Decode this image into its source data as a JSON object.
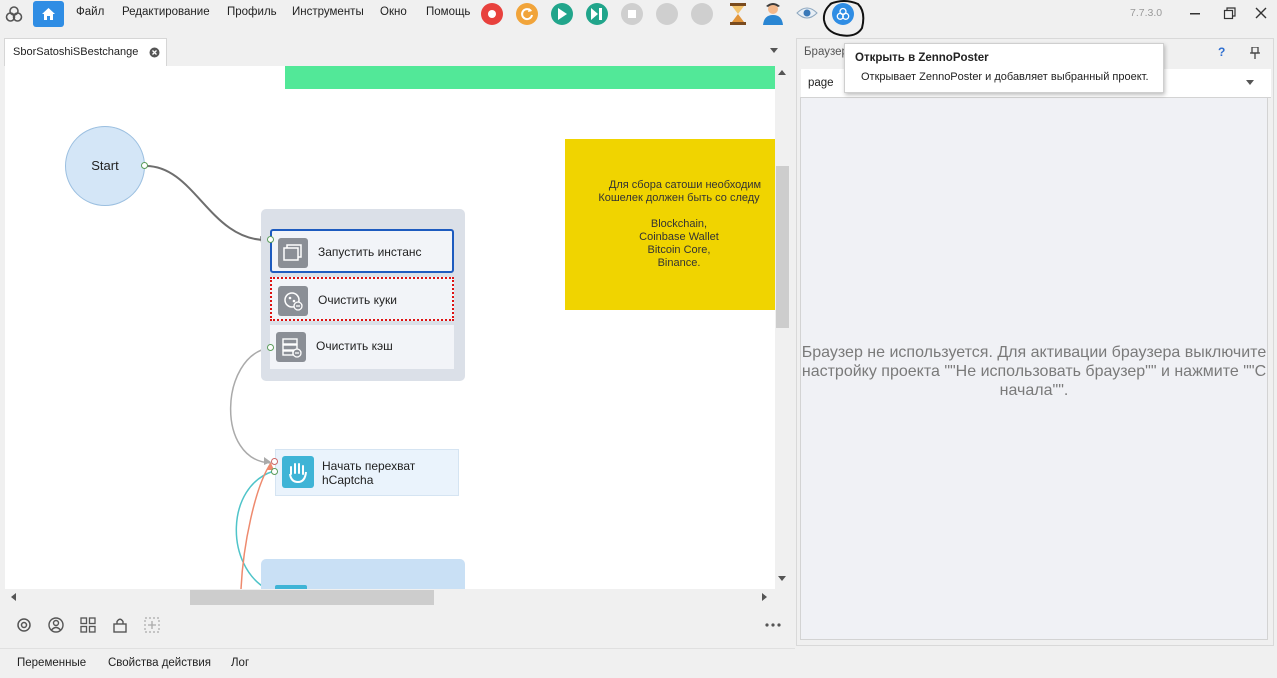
{
  "menu": {
    "file": "Файл",
    "edit": "Редактирование",
    "profile": "Профиль",
    "tools": "Инструменты",
    "window": "Окно",
    "help": "Помощь"
  },
  "toolbar_icons": [
    "home-icon",
    "record-icon",
    "refresh-icon",
    "play-icon",
    "step-icon",
    "stop-icon",
    "disabled-circle-icon",
    "disabled-circle-icon",
    "hourglass-icon",
    "user-icon",
    "eye-icon",
    "zennoposter-icon"
  ],
  "version": "7.7.3.0",
  "tabs": {
    "project": "SborSatoshiSBestchange"
  },
  "canvas": {
    "start_label": "Start",
    "actions": [
      "Запустить инстанс",
      "Очистить куки",
      "Очистить кэш"
    ],
    "hcaptcha_line1": "Начать перехват",
    "hcaptcha_line2": "hCaptcha",
    "note_lines": [
      "Для сбора сатоши необходим",
      "Кошелек должен быть со следу",
      "",
      "Blockchain,",
      "Coinbase Wallet",
      "Bitcoin Core,",
      "Binance."
    ]
  },
  "right_panel": {
    "title": "Браузер",
    "help": "?",
    "tab_page": "page",
    "message": "Браузер не используется. Для активации браузера выключите настройку проекта \"\"Не использовать браузер\"\" и нажмите \"\"С начала\"\"."
  },
  "tooltip": {
    "title": "Открыть в ZennoPoster",
    "text": "Открывает ZennoPoster и добавляет выбранный проект."
  },
  "bottom_tabs": [
    "Переменные",
    "Свойства действия",
    "Лог"
  ],
  "colors": {
    "accent": "#2f8de4",
    "note": "#f0d400",
    "green_bar": "#52e898",
    "selection": "#1d5bbf"
  }
}
